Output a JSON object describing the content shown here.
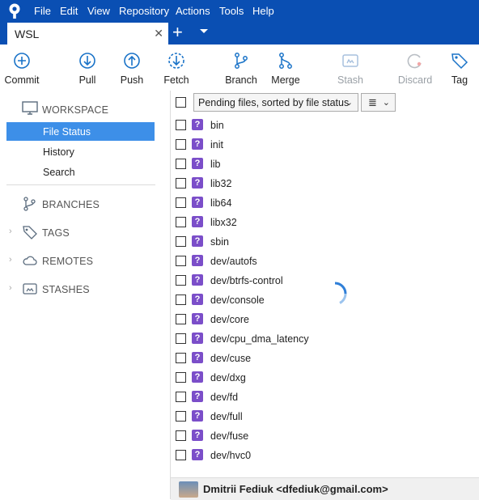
{
  "menubar": {
    "items": [
      "File",
      "Edit",
      "View",
      "Repository",
      "Actions",
      "Tools",
      "Help"
    ]
  },
  "tabs": {
    "active_label": "WSL",
    "close_glyph": "✕",
    "add_glyph": "+"
  },
  "toolbar": {
    "commit": "Commit",
    "pull": "Pull",
    "push": "Push",
    "fetch": "Fetch",
    "branch": "Branch",
    "merge": "Merge",
    "stash": "Stash",
    "discard": "Discard",
    "tag": "Tag"
  },
  "sidebar": {
    "workspace": "WORKSPACE",
    "file_status": "File Status",
    "history": "History",
    "search": "Search",
    "branches": "BRANCHES",
    "tags": "TAGS",
    "remotes": "REMOTES",
    "stashes": "STASHES"
  },
  "filter": {
    "dropdown_label": "Pending files, sorted by file status",
    "view_icon": "≣"
  },
  "files": [
    "bin",
    "init",
    "lib",
    "lib32",
    "lib64",
    "libx32",
    "sbin",
    "dev/autofs",
    "dev/btrfs-control",
    "dev/console",
    "dev/core",
    "dev/cpu_dma_latency",
    "dev/cuse",
    "dev/dxg",
    "dev/fd",
    "dev/full",
    "dev/fuse",
    "dev/hvc0"
  ],
  "file_status_glyph": "?",
  "status": {
    "user": "Dmitrii Fediuk <dfediuk@gmail.com>"
  },
  "colors": {
    "accent": "#0a4fb3",
    "selection": "#3d8fe8",
    "untracked": "#7b4ec9"
  }
}
